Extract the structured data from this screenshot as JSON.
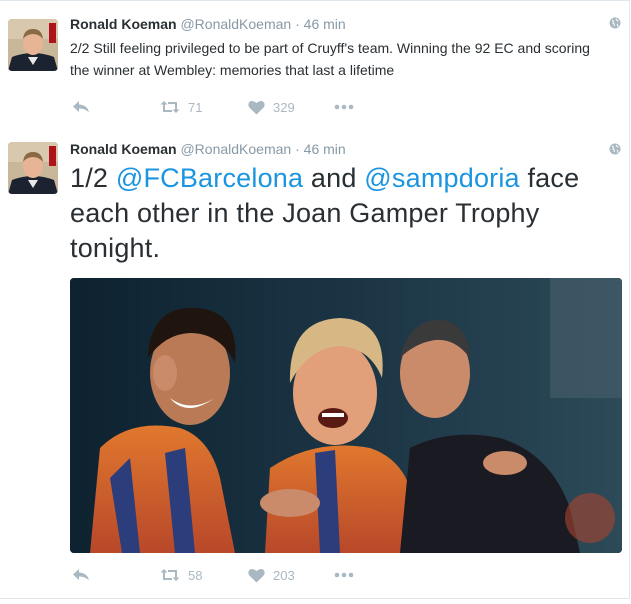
{
  "tweets": [
    {
      "name": "Ronald Koeman",
      "handle": "@RonaldKoeman",
      "separator": "·",
      "time": "46 min",
      "text": "2/2 Still feeling privileged to be part of Cruyff's team. Winning the 92 EC and scoring the winner at Wembley: memories that last a lifetime",
      "retweets": "71",
      "likes": "329"
    },
    {
      "name": "Ronald Koeman",
      "handle": "@RonaldKoeman",
      "separator": "·",
      "time": "46 min",
      "text_parts": {
        "prefix": "1/2 ",
        "mention1": "@FCBarcelona",
        "middle": " and ",
        "mention2": "@sampdoria",
        "suffix": " face each other in the Joan Gamper Trophy tonight."
      },
      "retweets": "58",
      "likes": "203"
    }
  ],
  "colors": {
    "text": "#292f33",
    "muted": "#8899a6",
    "icon": "#aab8c2",
    "link": "#1b95e0",
    "border": "#e1e8ed"
  },
  "icons": [
    "globe-icon",
    "reply-icon",
    "retweet-icon",
    "like-icon",
    "more-icon"
  ]
}
